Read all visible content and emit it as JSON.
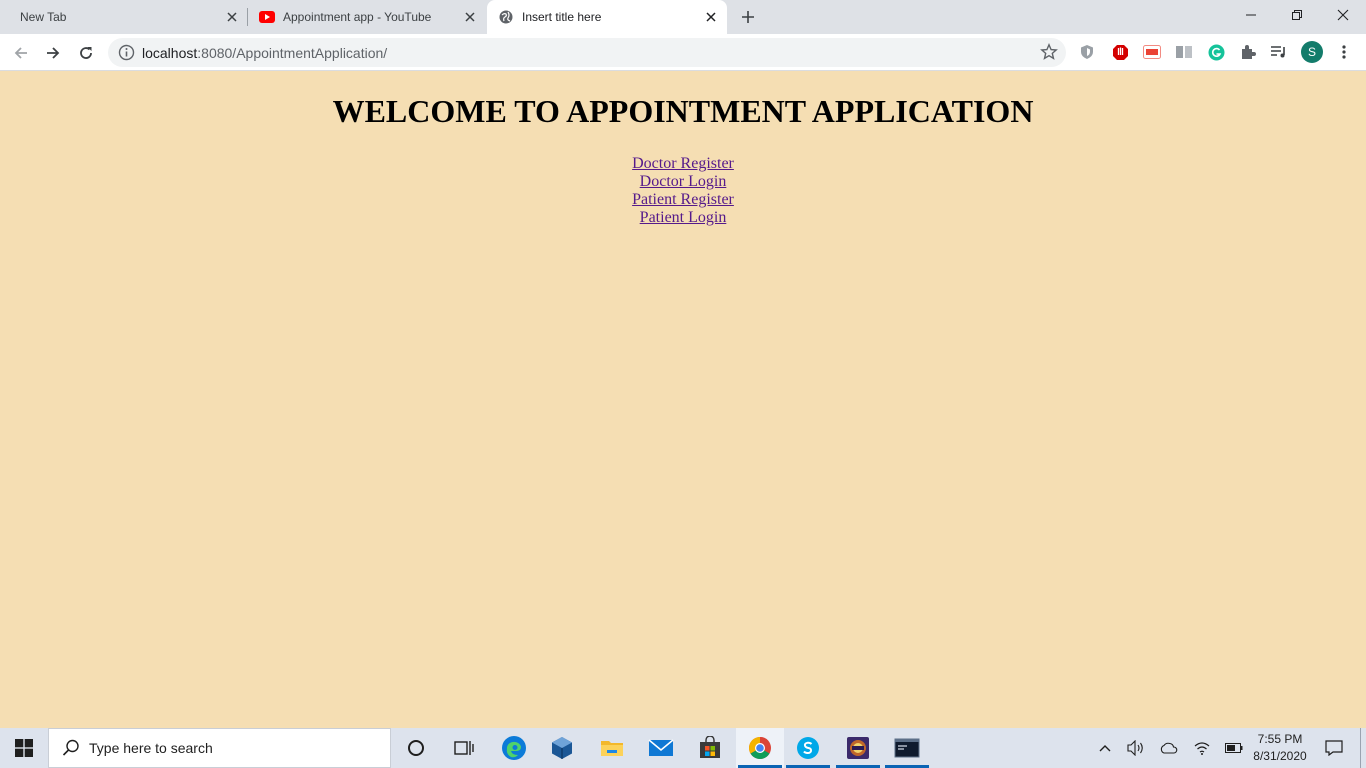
{
  "browser": {
    "tabs": [
      {
        "title": "New Tab"
      },
      {
        "title": "Appointment app - YouTube"
      },
      {
        "title": "Insert title here"
      }
    ],
    "url_host": "localhost",
    "url_rest": ":8080/AppointmentApplication/"
  },
  "page": {
    "heading": "WELCOME TO APPOINTMENT APPLICATION",
    "links": [
      "Doctor Register",
      "Doctor Login",
      "Patient Register",
      "Patient Login"
    ]
  },
  "taskbar": {
    "search_placeholder": "Type here to search",
    "time": "7:55 PM",
    "date": "8/31/2020"
  },
  "profile": {
    "initial": "S"
  },
  "colors": {
    "page_background": "#f5deb3",
    "link": "#551a8b",
    "tabstrip": "#dee1e6"
  }
}
